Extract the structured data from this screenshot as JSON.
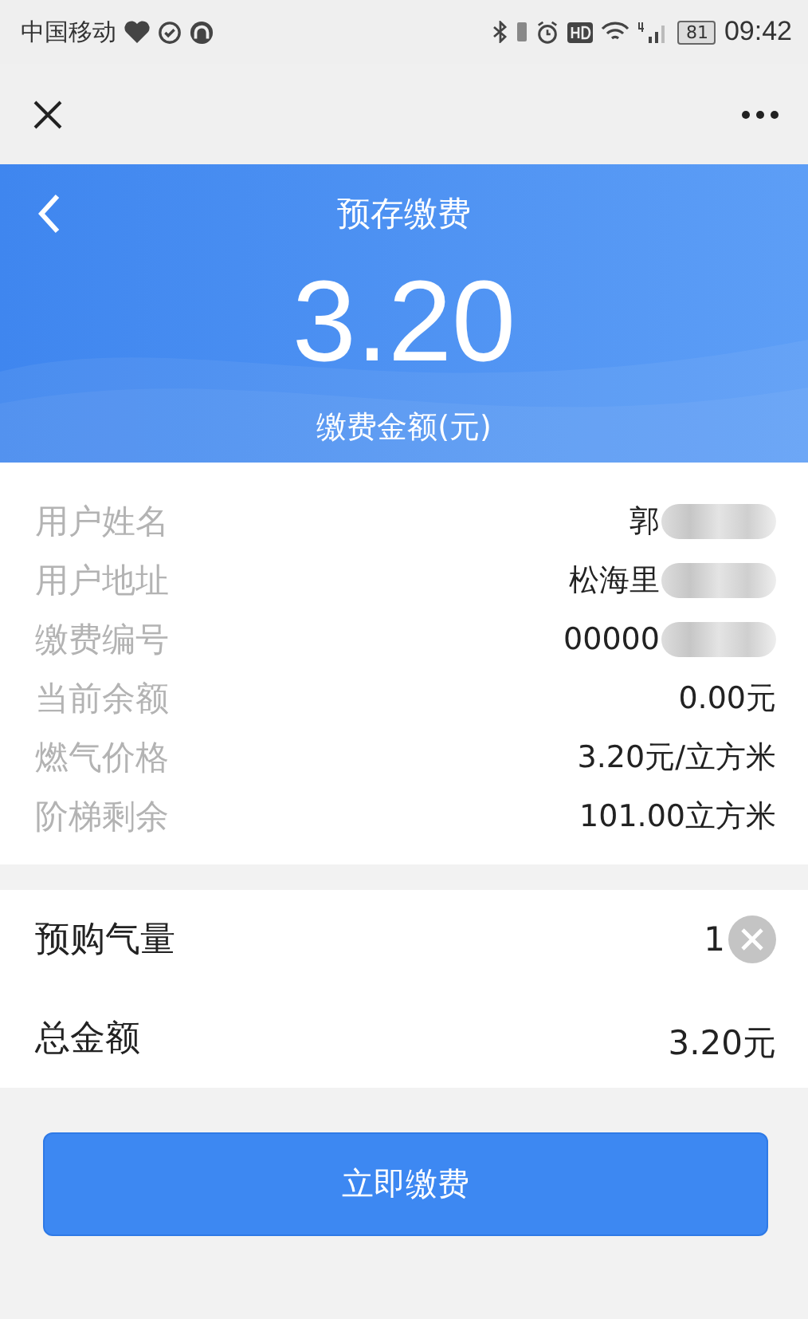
{
  "status_bar": {
    "carrier": "中国移动",
    "battery": "81",
    "time": "09:42"
  },
  "header": {
    "title": "预存缴费",
    "amount": "3.20",
    "caption": "缴费金额(元)"
  },
  "info_rows": [
    {
      "label": "用户姓名",
      "value": "郭",
      "redacted": true
    },
    {
      "label": "用户地址",
      "value": "松海里",
      "redacted": true
    },
    {
      "label": "缴费编号",
      "value": "00000",
      "redacted": true
    },
    {
      "label": "当前余额",
      "value": "0.00元",
      "redacted": false
    },
    {
      "label": "燃气价格",
      "value": "3.20元/立方米",
      "redacted": false
    },
    {
      "label": "阶梯剩余",
      "value": "101.00立方米",
      "redacted": false
    }
  ],
  "purchase": {
    "label": "预购气量",
    "value": "1"
  },
  "total": {
    "label": "总金额",
    "value": "3.20元"
  },
  "pay_button": "立即缴费"
}
